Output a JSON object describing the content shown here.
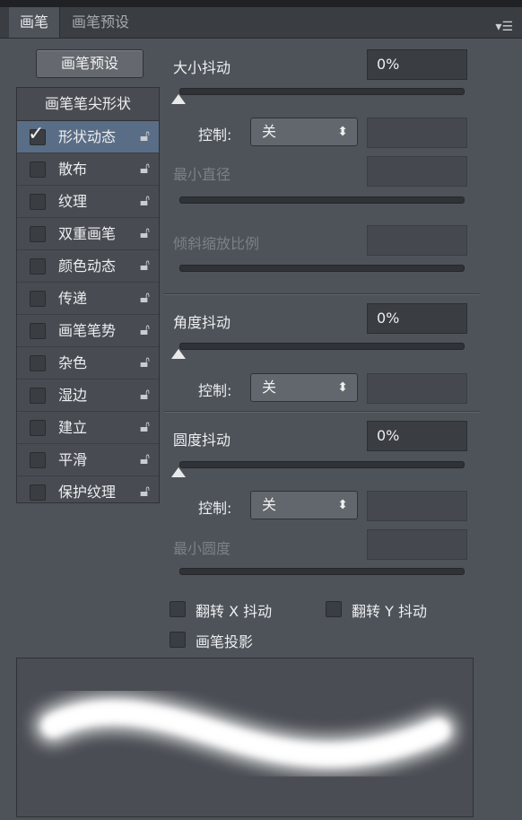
{
  "tabs": [
    {
      "label": "画笔"
    },
    {
      "label": "画笔预设"
    }
  ],
  "menu_icon": "panel-menu-icon",
  "preset_button": "画笔预设",
  "list": {
    "header": "画笔笔尖形状",
    "items": [
      {
        "label": "形状动态",
        "checked": true,
        "selected": true
      },
      {
        "label": "散布",
        "checked": false
      },
      {
        "label": "纹理",
        "checked": false
      },
      {
        "label": "双重画笔",
        "checked": false
      },
      {
        "label": "颜色动态",
        "checked": false
      },
      {
        "label": "传递",
        "checked": false
      },
      {
        "label": "画笔笔势",
        "checked": false
      },
      {
        "label": "杂色",
        "checked": false
      },
      {
        "label": "湿边",
        "checked": false
      },
      {
        "label": "建立",
        "checked": false
      },
      {
        "label": "平滑",
        "checked": false
      },
      {
        "label": "保护纹理",
        "checked": false
      }
    ]
  },
  "size_jitter": {
    "label": "大小抖动",
    "value": "0%",
    "control_label": "控制:",
    "control_value": "关"
  },
  "min_diameter": {
    "label": "最小直径"
  },
  "tilt_scale": {
    "label": "倾斜缩放比例"
  },
  "angle_jitter": {
    "label": "角度抖动",
    "value": "0%",
    "control_label": "控制:",
    "control_value": "关"
  },
  "roundness_jitter": {
    "label": "圆度抖动",
    "value": "0%",
    "control_label": "控制:",
    "control_value": "关"
  },
  "min_roundness": {
    "label": "最小圆度"
  },
  "flip_x": {
    "label": "翻转 X 抖动",
    "checked": false
  },
  "flip_y": {
    "label": "翻转 Y 抖动",
    "checked": false
  },
  "brush_projection": {
    "label": "画笔投影",
    "checked": false
  },
  "colors": {
    "panel": "#4e5359",
    "selected_row": "#5a6d86",
    "stroke": "#ffffff"
  }
}
